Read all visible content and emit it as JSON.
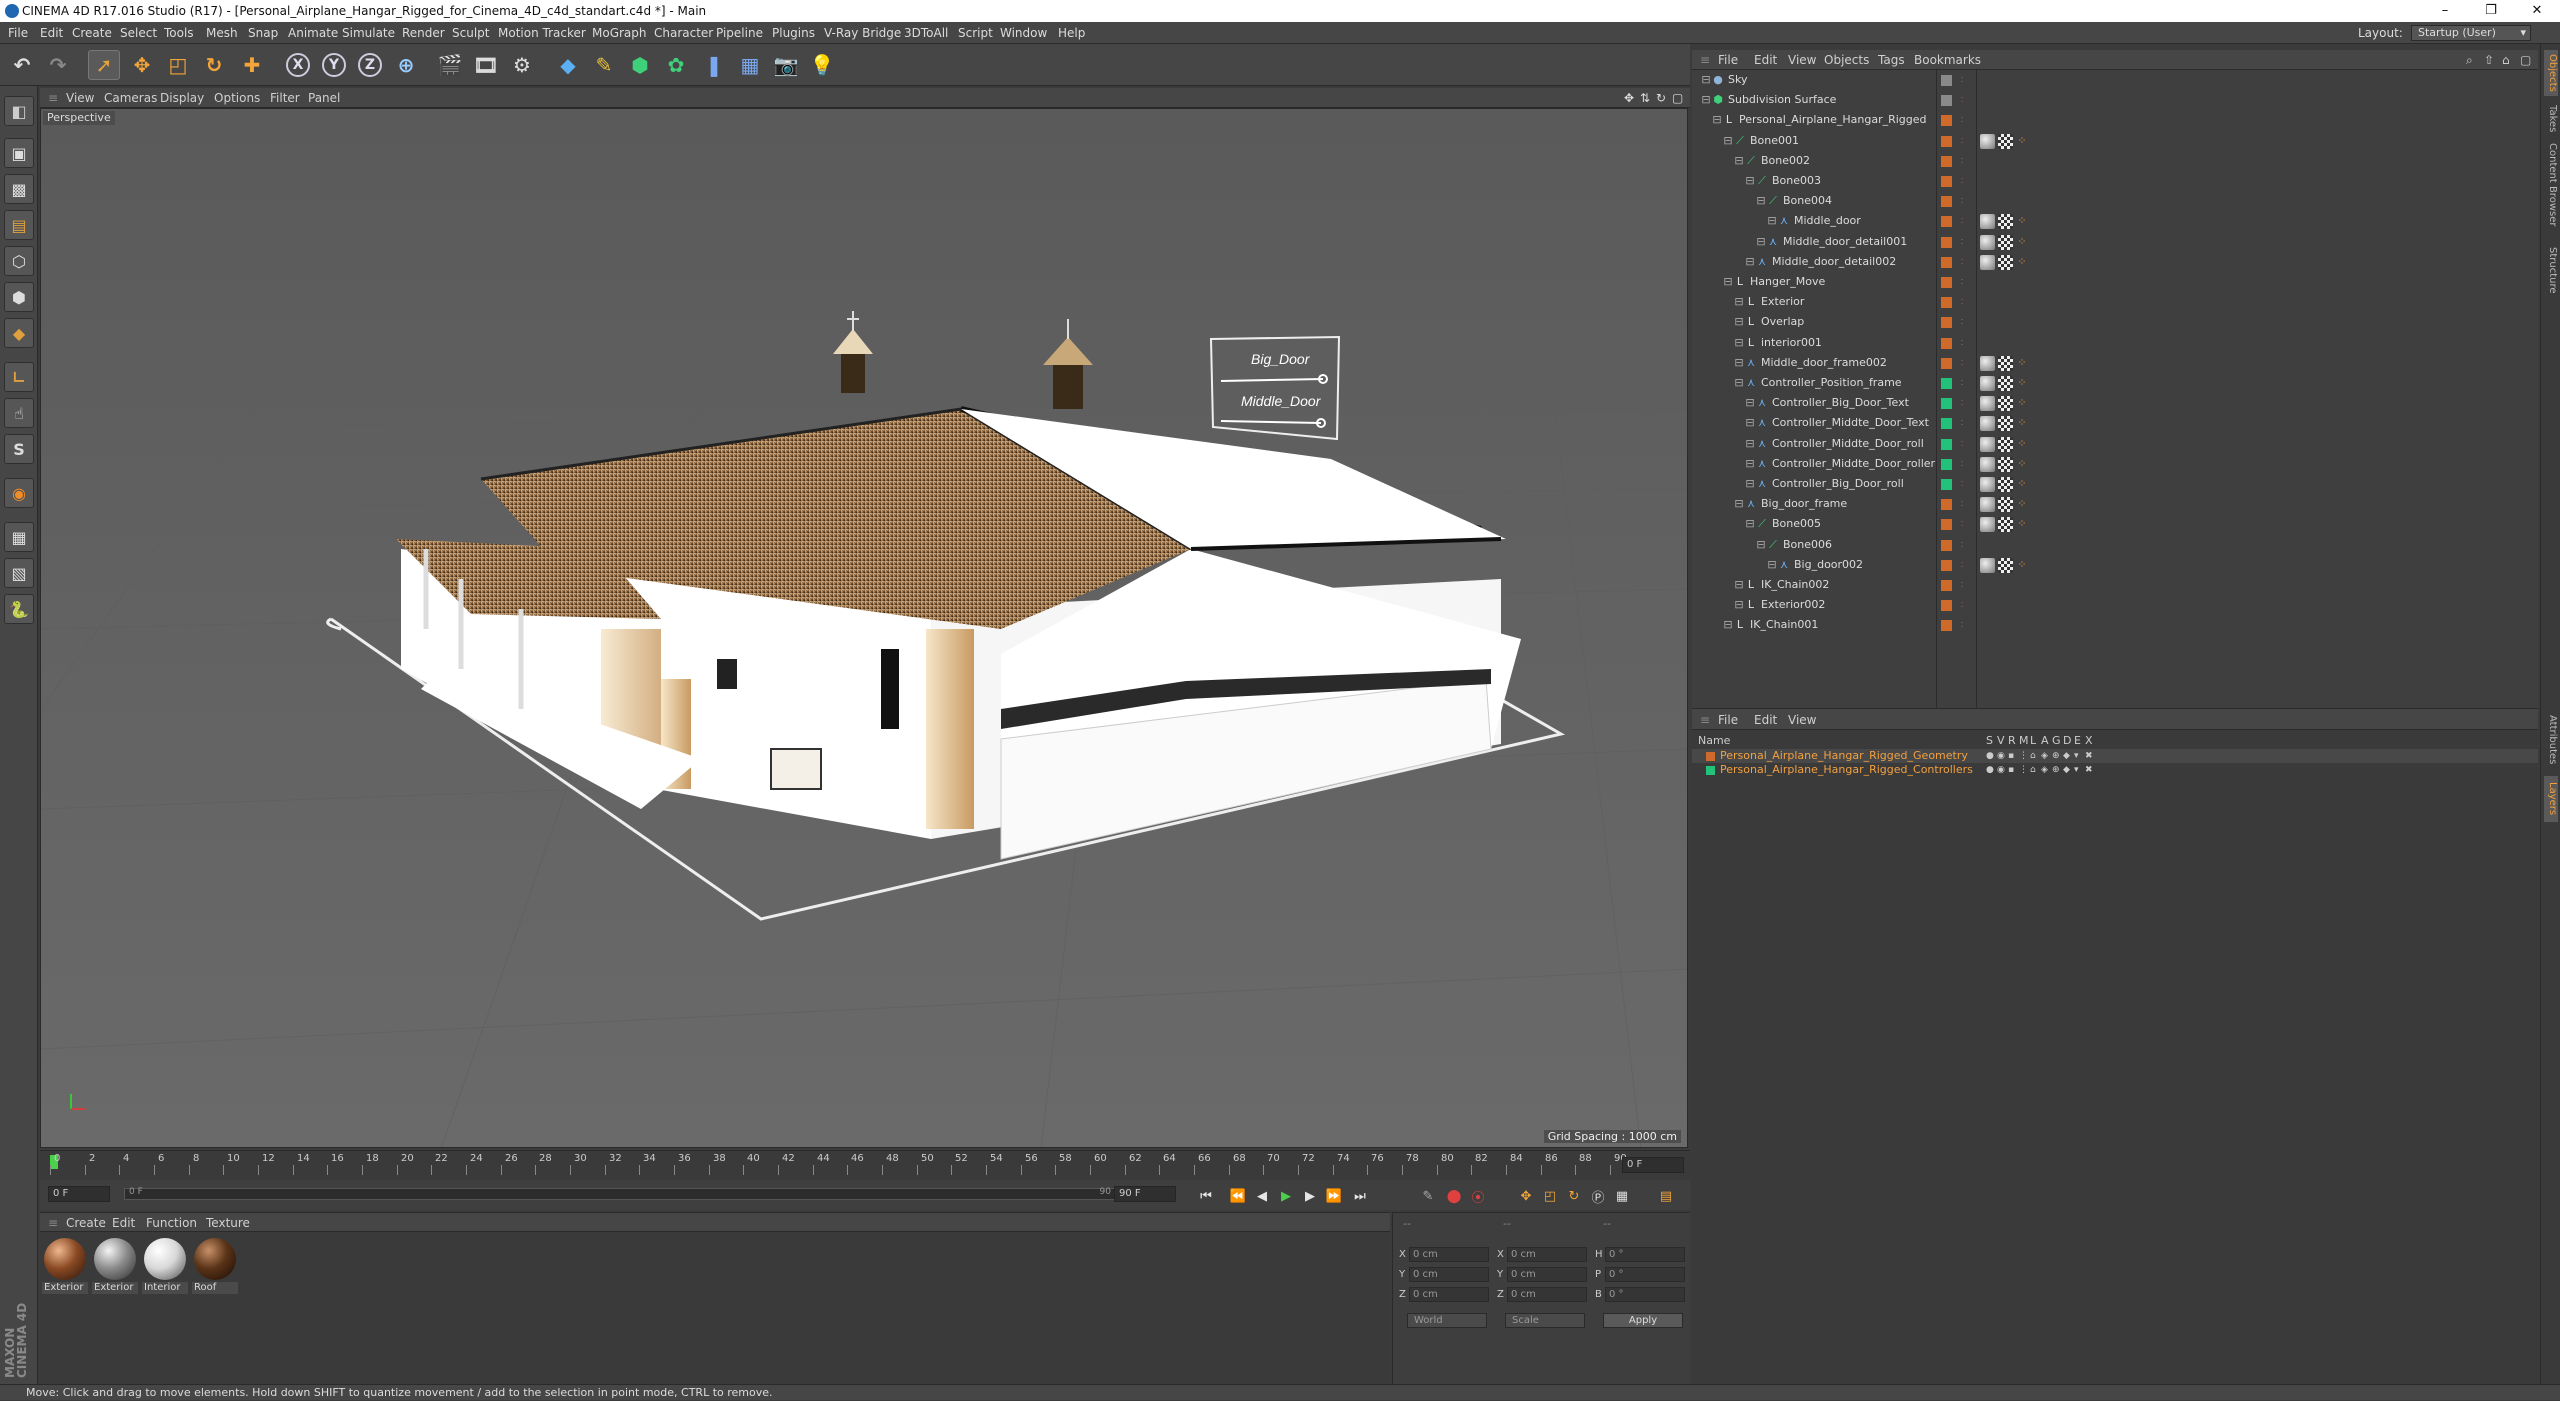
{
  "window": {
    "title": "CINEMA 4D R17.016 Studio (R17) - [Personal_Airplane_Hangar_Rigged_for_Cinema_4D_c4d_standart.c4d *] - Main",
    "controls": [
      "–",
      "❐",
      "✕"
    ]
  },
  "menubar": {
    "items": [
      "File",
      "Edit",
      "Create",
      "Select",
      "Tools",
      "Mesh",
      "Snap",
      "Animate",
      "Simulate",
      "Render",
      "Sculpt",
      "Motion Tracker",
      "MoGraph",
      "Character",
      "Pipeline",
      "Plugins",
      "V-Ray Bridge",
      "3DToAll",
      "Script",
      "Window",
      "Help"
    ],
    "layout_label": "Layout:",
    "layout_value": "Startup (User)"
  },
  "toolbar": {
    "axis_x": "X",
    "axis_y": "Y",
    "axis_z": "Z"
  },
  "viewport": {
    "menu": [
      "View",
      "Cameras",
      "Display",
      "Options",
      "Filter",
      "Panel"
    ],
    "camera_label": "Perspective",
    "grid_spacing": "Grid Spacing : 1000 cm",
    "sign_big_door": "Big_Door",
    "sign_middle_door": "Middle_Door"
  },
  "timeline": {
    "ticks": [
      "0",
      "2",
      "4",
      "6",
      "8",
      "10",
      "12",
      "14",
      "16",
      "18",
      "20",
      "22",
      "24",
      "26",
      "28",
      "30",
      "32",
      "34",
      "36",
      "38",
      "40",
      "42",
      "44",
      "46",
      "48",
      "50",
      "52",
      "54",
      "56",
      "58",
      "60",
      "62",
      "64",
      "66",
      "68",
      "70",
      "72",
      "74",
      "76",
      "78",
      "80",
      "82",
      "84",
      "86",
      "88",
      "90"
    ],
    "current_frame": "0 F",
    "start_field": "0 F",
    "range_start": "0 F",
    "range_end": "90 F",
    "end_field": "90 F"
  },
  "materials": {
    "menu": [
      "Create",
      "Edit",
      "Function",
      "Texture"
    ],
    "items": [
      {
        "name": "Exterior",
        "color": "#8a4a24"
      },
      {
        "name": "Exterior",
        "color": "#8c8c8c"
      },
      {
        "name": "Interior",
        "color": "#d8d8d8"
      },
      {
        "name": "Roof",
        "color": "#5a3418"
      }
    ]
  },
  "coordinates": {
    "header_left": "--",
    "header_mid": "--",
    "header_right": "--",
    "rows": [
      {
        "a1": "X",
        "v1": "0 cm",
        "a2": "X",
        "v2": "0 cm",
        "a3": "H",
        "v3": "0 °"
      },
      {
        "a1": "Y",
        "v1": "0 cm",
        "a2": "Y",
        "v2": "0 cm",
        "a3": "P",
        "v3": "0 °"
      },
      {
        "a1": "Z",
        "v1": "0 cm",
        "a2": "Z",
        "v2": "0 cm",
        "a3": "B",
        "v3": "0 °"
      }
    ],
    "mode_world": "World",
    "mode_scale": "Scale",
    "apply": "Apply"
  },
  "object_manager": {
    "menu": [
      "File",
      "Edit",
      "View",
      "Objects",
      "Tags",
      "Bookmarks"
    ],
    "objects": [
      {
        "name": "Sky",
        "indent": 0,
        "icon": "sky",
        "color": "#8a8a8a"
      },
      {
        "name": "Subdivision Surface",
        "indent": 0,
        "icon": "subdiv",
        "color": "#8a8a8a"
      },
      {
        "name": "Personal_Airplane_Hangar_Rigged",
        "indent": 1,
        "icon": "null",
        "color": "#d06a2a"
      },
      {
        "name": "Bone001",
        "indent": 2,
        "icon": "bone",
        "color": "#d06a2a"
      },
      {
        "name": "Bone002",
        "indent": 3,
        "icon": "bone",
        "color": "#d06a2a"
      },
      {
        "name": "Bone003",
        "indent": 4,
        "icon": "bone",
        "color": "#d06a2a"
      },
      {
        "name": "Bone004",
        "indent": 5,
        "icon": "bone",
        "color": "#d06a2a"
      },
      {
        "name": "Middle_door",
        "indent": 6,
        "icon": "poly",
        "color": "#d06a2a"
      },
      {
        "name": "Middle_door_detail001",
        "indent": 5,
        "icon": "poly",
        "color": "#d06a2a"
      },
      {
        "name": "Middle_door_detail002",
        "indent": 4,
        "icon": "poly",
        "color": "#d06a2a"
      },
      {
        "name": "Hanger_Move",
        "indent": 2,
        "icon": "null",
        "color": "#d06a2a"
      },
      {
        "name": "Exterior",
        "indent": 3,
        "icon": "null",
        "color": "#d06a2a"
      },
      {
        "name": "Overlap",
        "indent": 3,
        "icon": "null",
        "color": "#d06a2a"
      },
      {
        "name": "interior001",
        "indent": 3,
        "icon": "null",
        "color": "#d06a2a"
      },
      {
        "name": "Middle_door_frame002",
        "indent": 3,
        "icon": "poly",
        "color": "#d06a2a"
      },
      {
        "name": "Controller_Position_frame",
        "indent": 3,
        "icon": "poly",
        "color": "#22c27a"
      },
      {
        "name": "Controller_Big_Door_Text",
        "indent": 4,
        "icon": "poly",
        "color": "#22c27a"
      },
      {
        "name": "Controller_Middte_Door_Text",
        "indent": 4,
        "icon": "poly",
        "color": "#22c27a"
      },
      {
        "name": "Controller_Middte_Door_roll",
        "indent": 4,
        "icon": "poly",
        "color": "#22c27a"
      },
      {
        "name": "Controller_Middte_Door_roller",
        "indent": 4,
        "icon": "poly",
        "color": "#22c27a"
      },
      {
        "name": "Controller_Big_Door_roll",
        "indent": 4,
        "icon": "poly",
        "color": "#22c27a"
      },
      {
        "name": "Big_door_frame",
        "indent": 3,
        "icon": "poly",
        "color": "#d06a2a"
      },
      {
        "name": "Bone005",
        "indent": 4,
        "icon": "bone",
        "color": "#d06a2a"
      },
      {
        "name": "Bone006",
        "indent": 5,
        "icon": "bone",
        "color": "#d06a2a"
      },
      {
        "name": "Big_door002",
        "indent": 6,
        "icon": "poly",
        "color": "#d06a2a"
      },
      {
        "name": "IK_Chain002",
        "indent": 3,
        "icon": "null",
        "color": "#d06a2a"
      },
      {
        "name": "Exterior002",
        "indent": 3,
        "icon": "null",
        "color": "#d06a2a"
      },
      {
        "name": "IK_Chain001",
        "indent": 2,
        "icon": "null",
        "color": "#d06a2a"
      }
    ]
  },
  "layer_manager": {
    "menu": [
      "File",
      "Edit",
      "View"
    ],
    "header_name": "Name",
    "header_cols": [
      "S",
      "V",
      "R",
      "M",
      "L",
      "A",
      "G",
      "D",
      "E",
      "X"
    ],
    "layers": [
      {
        "name": "Personal_Airplane_Hangar_Rigged_Geometry",
        "color": "#d06a2a"
      },
      {
        "name": "Personal_Airplane_Hangar_Rigged_Controllers",
        "color": "#22c27a"
      }
    ]
  },
  "right_tabs": [
    "Objects",
    "Takes",
    "Content Browser",
    "Structure",
    "Attributes",
    "Layers"
  ],
  "status": "Move: Click and drag to move elements. Hold down SHIFT to quantize movement / add to the selection in point mode, CTRL to remove.",
  "brand": "MAXON CINEMA 4D"
}
